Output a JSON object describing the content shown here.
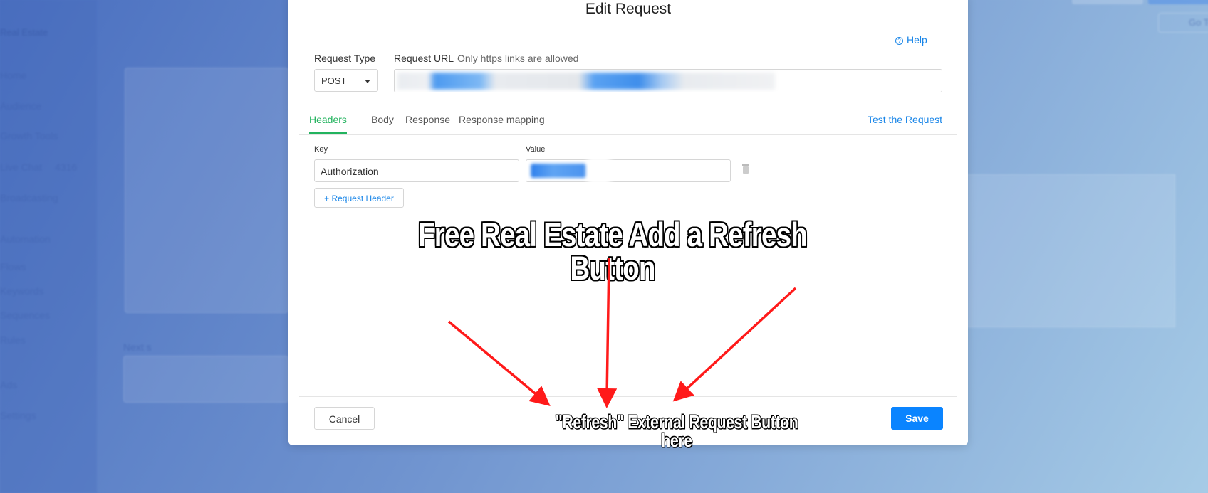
{
  "background": {
    "account": "Real Estate",
    "nav": [
      "Home",
      "Audience",
      "Growth Tools",
      "Live Chat",
      "Broadcasting",
      "Automation",
      "Flows",
      "Keywords",
      "Sequences",
      "Rules",
      "Ads",
      "Settings"
    ],
    "live_chat_count": "4316",
    "next_step_label": "Next s",
    "goto_label": "Go To"
  },
  "modal": {
    "title": "Edit Request",
    "help": "Help",
    "request_type_label": "Request Type",
    "request_type_value": "POST",
    "request_url_label": "Request URL",
    "request_url_hint": "Only https links are allowed",
    "tabs": [
      {
        "label": "Headers",
        "active": true
      },
      {
        "label": "Body",
        "active": false
      },
      {
        "label": "Response",
        "active": false
      },
      {
        "label": "Response mapping",
        "active": false
      }
    ],
    "test_link": "Test the Request",
    "key_label": "Key",
    "value_label": "Value",
    "header_key": "Authorization",
    "add_header": "+ Request Header",
    "cancel": "Cancel",
    "save": "Save"
  },
  "annotation": {
    "title": "Free Real Estate Add a Refresh Button",
    "subtitle": "\"Refresh\" External Request Button here",
    "arrow_color": "#ff1a1a"
  },
  "colors": {
    "accent_green": "#22b35e",
    "link_blue": "#1a86e8",
    "save_blue": "#0a84ff"
  }
}
